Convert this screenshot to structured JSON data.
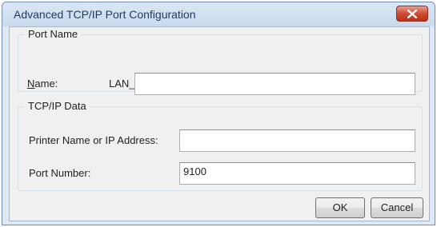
{
  "window": {
    "title": "Advanced TCP/IP Port Configuration",
    "close_icon": "close-x-icon"
  },
  "port_name_group": {
    "legend": "Port Name",
    "name_label_accel": "N",
    "name_label_rest": "ame:",
    "name_value": "LAN_"
  },
  "tcpip_group": {
    "legend": "TCP/IP Data",
    "printer_label": "Printer Name or IP Address:",
    "printer_value": "",
    "port_label": "Port Number:",
    "port_value": "9100"
  },
  "buttons": {
    "ok": "OK",
    "cancel": "Cancel"
  },
  "colors": {
    "title_text": "#1e395b",
    "close_button": "#cf4b34",
    "dialog_bg": "#f0f0f0"
  }
}
